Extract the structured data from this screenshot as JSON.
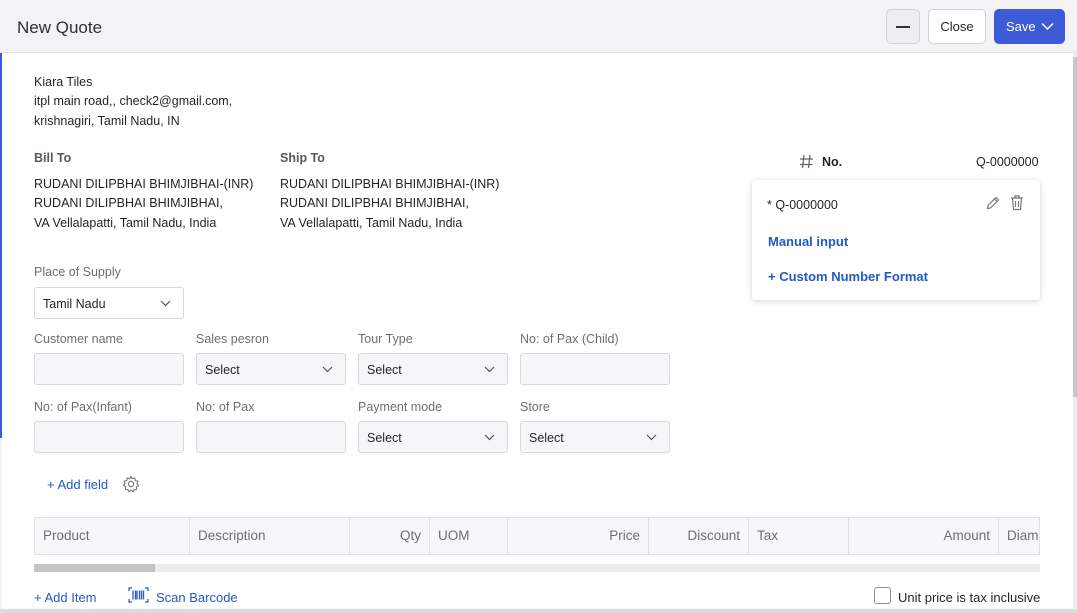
{
  "window": {
    "title": "New Quote"
  },
  "toolbar": {
    "close_label": "Close",
    "save_label": "Save"
  },
  "company": {
    "name": "Kiara Tiles",
    "address_line1": "itpl main road,, check2@gmail.com,",
    "address_line2": "krishnagiri, Tamil Nadu, IN"
  },
  "bill_to": {
    "heading": "Bill To",
    "name": "RUDANI DILIPBHAI BHIMJIBHAI-(INR)",
    "line1": "RUDANI DILIPBHAI BHIMJIBHAI,",
    "line2": "VA Vellalapatti, Tamil Nadu, India"
  },
  "ship_to": {
    "heading": "Ship To",
    "name": "RUDANI DILIPBHAI BHIMJIBHAI-(INR)",
    "line1": "RUDANI DILIPBHAI BHIMJIBHAI,",
    "line2": "VA Vellalapatti, Tamil Nadu, India"
  },
  "number": {
    "label": "No.",
    "value": "Q-0000000"
  },
  "number_popup": {
    "current": "* Q-0000000",
    "manual_input": "Manual input",
    "custom_format": "+ Custom Number Format"
  },
  "place_of_supply": {
    "label": "Place of Supply",
    "value": "Tamil Nadu"
  },
  "fields": {
    "customer_name": {
      "label": "Customer name",
      "value": ""
    },
    "sales_person": {
      "label": "Sales pesron",
      "value": "Select"
    },
    "tour_type": {
      "label": "Tour Type",
      "value": "Select"
    },
    "pax_child": {
      "label": "No: of Pax (Child)",
      "value": ""
    },
    "pax_infant": {
      "label": "No: of Pax(Infant)",
      "value": ""
    },
    "pax": {
      "label": "No: of Pax",
      "value": ""
    },
    "payment_mode": {
      "label": "Payment mode",
      "value": "Select"
    },
    "store": {
      "label": "Store",
      "value": "Select"
    }
  },
  "add_field_label": "+ Add field",
  "table": {
    "columns": [
      "Product",
      "Description",
      "Qty",
      "UOM",
      "Price",
      "Discount",
      "Tax",
      "Amount",
      "Diam"
    ]
  },
  "footer": {
    "add_item": "+ Add Item",
    "scan_barcode": "Scan Barcode",
    "tax_inclusive_label": "Unit price is tax inclusive",
    "tax_inclusive_checked": false
  },
  "colors": {
    "accent": "#3d5bd9",
    "link": "#2359c4"
  },
  "icons": [
    "minimize-icon",
    "chevron-down-icon",
    "hash-icon",
    "pencil-icon",
    "trash-icon",
    "gear-icon",
    "barcode-icon"
  ]
}
